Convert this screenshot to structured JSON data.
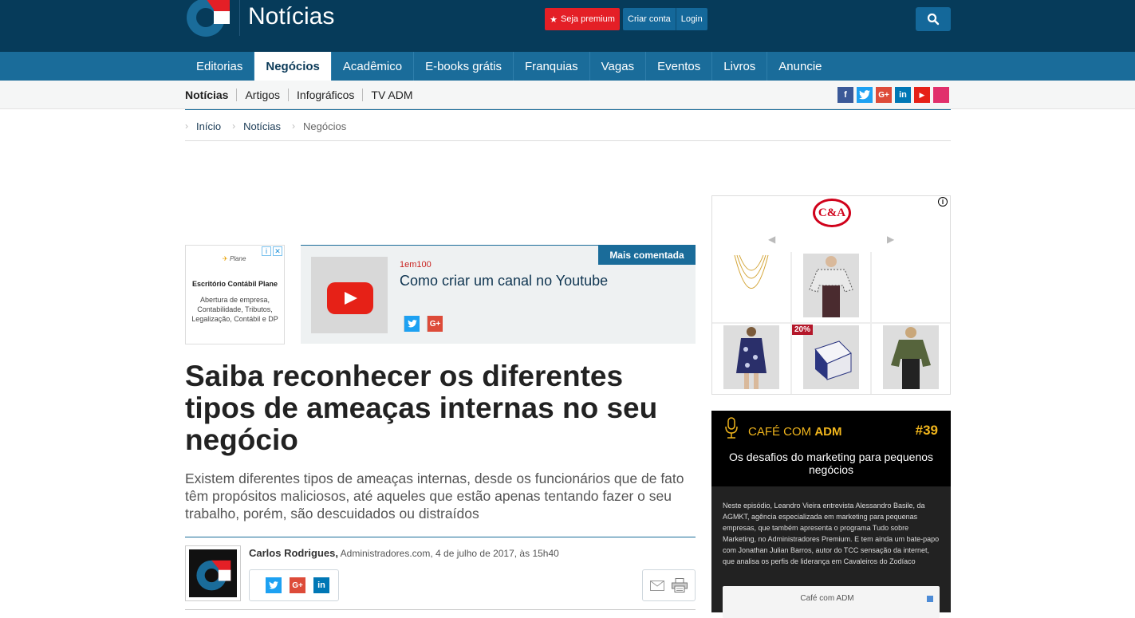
{
  "header": {
    "site_title": "Notícias",
    "premium_label": "Seja premium",
    "create_account_label": "Criar conta",
    "login_label": "Login"
  },
  "main_nav": {
    "items": [
      "Editorias",
      "Negócios",
      "Acadêmico",
      "E-books grátis",
      "Franquias",
      "Vagas",
      "Eventos",
      "Livros",
      "Anuncie"
    ],
    "active": "Negócios"
  },
  "sub_nav": {
    "items": [
      "Notícias",
      "Artigos",
      "Infográficos",
      "TV ADM"
    ]
  },
  "social": {
    "facebook": "f",
    "twitter": "t",
    "googleplus": "G+",
    "linkedin": "in",
    "youtube": "▶",
    "colors": {
      "facebook": "#3b5998",
      "twitter": "#1da1f2",
      "googleplus": "#dd4b39",
      "linkedin": "#0077b5",
      "youtube": "#e62117",
      "instagram": "#e1306c"
    }
  },
  "breadcrumb": [
    "Início",
    "Notícias",
    "Negócios"
  ],
  "ad_left": {
    "brand": "Plane",
    "title": "Escritório Contábil Plane",
    "description": "Abertura de empresa, Contabilidade, Tributos, Legalização, Contábil e DP"
  },
  "featured": {
    "tag": "Mais comentada",
    "source": "1em100",
    "title": "Como criar um canal no Youtube"
  },
  "article": {
    "headline": "Saiba reconhecer os diferentes tipos de ameaças internas no seu negócio",
    "deck": "Existem diferentes tipos de ameaças internas, desde os funcionários que de fato têm propósitos maliciosos, até aqueles que estão apenas tentando fazer o seu trabalho, porém, são descuidados ou distraídos",
    "author": "Carlos Rodrigues,",
    "meta": "Administradores.com, 4 de julho de 2017, às 15h40"
  },
  "ca_ad": {
    "logo": "C&A",
    "discount_badge": "20%"
  },
  "podcast": {
    "brand_light": "CAFÉ COM",
    "brand_bold": "ADM",
    "episode": "#39",
    "title": "Os desafios do marketing para pequenos negócios",
    "description": "Neste episódio, Leandro Vieira entrevista Alessandro Basile, da AGMKT, agência especializada em marketing para pequenas empresas, que também apresenta o programa Tudo sobre Marketing, no Administradores Premium. E tem ainda um bate-papo com Jonathan Julian Barros, autor do TCC sensação da internet, que analisa os perfis de liderança em Cavaleiros do Zodíaco",
    "player_label": "Café com ADM"
  }
}
